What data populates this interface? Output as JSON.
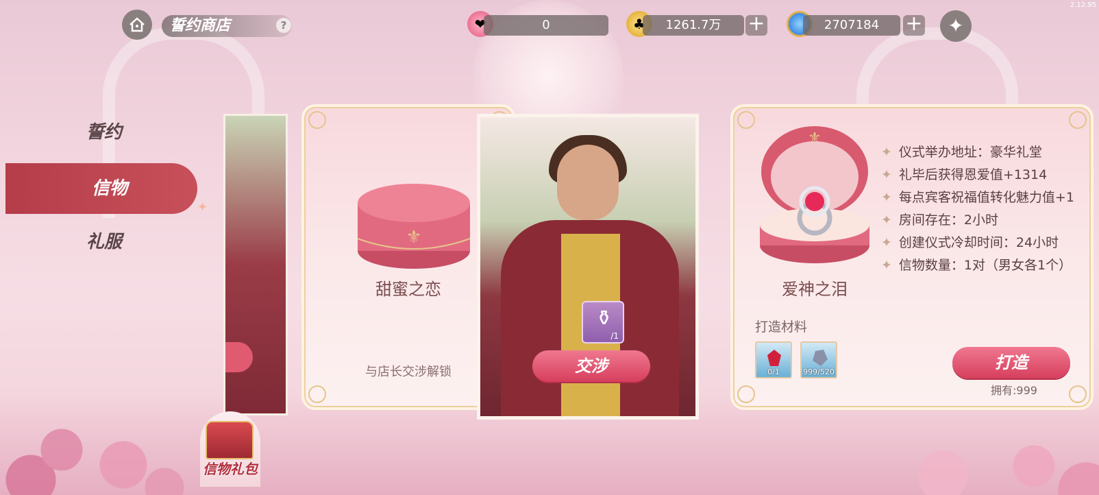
{
  "header": {
    "title": "誓约商店",
    "help_icon": "?",
    "version": "2.12.95",
    "currencies": [
      {
        "icon": "pink-gem-icon",
        "value": "0",
        "has_plus": false
      },
      {
        "icon": "gold-coin-icon",
        "value": "1261.7万",
        "has_plus": true
      },
      {
        "icon": "blue-diamond-icon",
        "value": "2707184",
        "has_plus": true
      }
    ]
  },
  "nav": {
    "items": [
      {
        "label": "誓约",
        "active": false
      },
      {
        "label": "信物",
        "active": true
      },
      {
        "label": "礼服",
        "active": false
      }
    ]
  },
  "cards": {
    "locked": {
      "name": "甜蜜之恋",
      "unlock_text": "与店长交涉解锁"
    },
    "character": {
      "item_qty": "/1",
      "button": "交涉"
    },
    "detail": {
      "name": "爱神之泪",
      "attributes": [
        "仪式举办地址：豪华礼堂",
        "礼毕后获得恩爱值+1314",
        "每点宾客祝福值转化魅力值+1",
        "房间存在：2小时",
        "创建仪式冷却时间：24小时",
        "信物数量：1对（男女各1个）"
      ],
      "materials_label": "打造材料",
      "materials": [
        {
          "icon": "ruby-icon",
          "count": "0/1"
        },
        {
          "icon": "crystal-icon",
          "count": "999/520"
        }
      ],
      "craft_button": "打造",
      "owned": "拥有:999"
    }
  },
  "gift_pack": {
    "label": "信物礼包"
  },
  "colors": {
    "accent_red": "#c7505a",
    "button_pink": "#e05a74",
    "card_bg": "#fbe9ea",
    "gold_trim": "#e6c48c"
  }
}
